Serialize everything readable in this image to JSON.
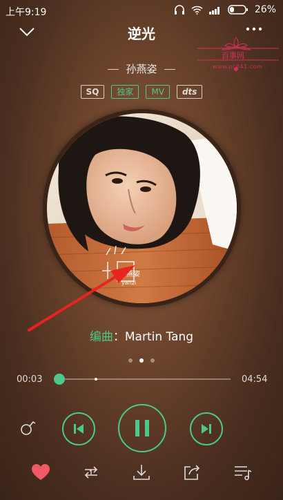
{
  "status_bar": {
    "time": "上午9:19",
    "battery": "26%"
  },
  "header": {
    "title": "逆光"
  },
  "watermark": {
    "title": "百事网",
    "url": "www.pc841.com"
  },
  "artist": {
    "name": "孙燕姿"
  },
  "badges": [
    "SQ",
    "独家",
    "MV",
    "dts"
  ],
  "album": {
    "text_cn": "孙燕姿",
    "text_en": "yanzi"
  },
  "composer": {
    "label": "编曲",
    "separator": "：",
    "value": "Martin Tang"
  },
  "progress": {
    "elapsed": "00:03",
    "total": "04:54",
    "fraction": 0.02
  },
  "colors": {
    "accent": "#4cc98a",
    "favorite": "#f05a67",
    "watermark": "#d0305a"
  },
  "icons": [
    "chevron-down-icon",
    "more-icon",
    "lyric-icon",
    "prev-icon",
    "pause-icon",
    "next-icon",
    "heart-icon",
    "repeat-icon",
    "download-icon",
    "share-icon",
    "playlist-icon"
  ]
}
